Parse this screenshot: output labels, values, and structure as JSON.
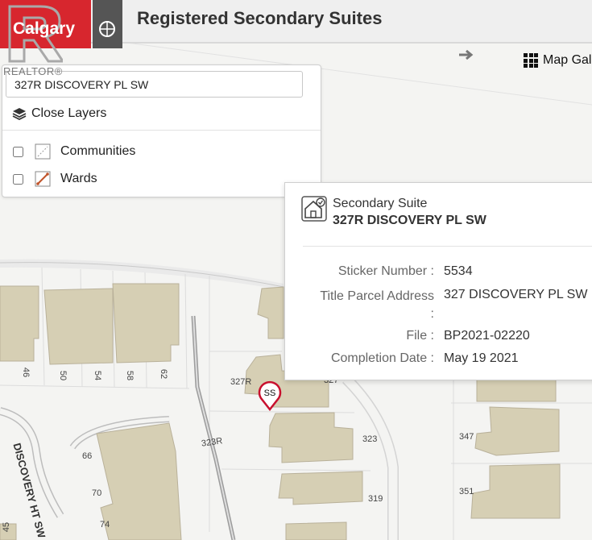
{
  "header": {
    "logo_text": "Calgary",
    "title": "Registered Secondary Suites",
    "watermark": "REALTOR®"
  },
  "toolbar": {
    "map_gallery_label": "Map Gal"
  },
  "layers_panel": {
    "search_value": "327R DISCOVERY PL SW",
    "close_label": "Close Layers",
    "layers": [
      {
        "label": "Communities",
        "checked": false
      },
      {
        "label": "Wards",
        "checked": false
      }
    ]
  },
  "popup": {
    "type": "Secondary Suite",
    "address": "327R DISCOVERY PL SW",
    "attributes": [
      {
        "label": "Sticker Number",
        "value": "5534"
      },
      {
        "label": "Title Parcel Address",
        "value": "327 DISCOVERY PL SW"
      },
      {
        "label": "File",
        "value": "BP2021-02220"
      },
      {
        "label": "Completion Date",
        "value": "May 19 2021"
      }
    ]
  },
  "map": {
    "marker_label": "SS",
    "street_labels": [
      "DISCOVERY HT SW",
      "323R"
    ],
    "lot_numbers": [
      "46",
      "50",
      "54",
      "58",
      "62",
      "327R",
      "327",
      "323",
      "319",
      "347",
      "351",
      "66",
      "70",
      "74",
      "45"
    ]
  },
  "colors": {
    "brand_red": "#d7262e",
    "building": "#d6cfb4",
    "marker": "#c8102e"
  }
}
